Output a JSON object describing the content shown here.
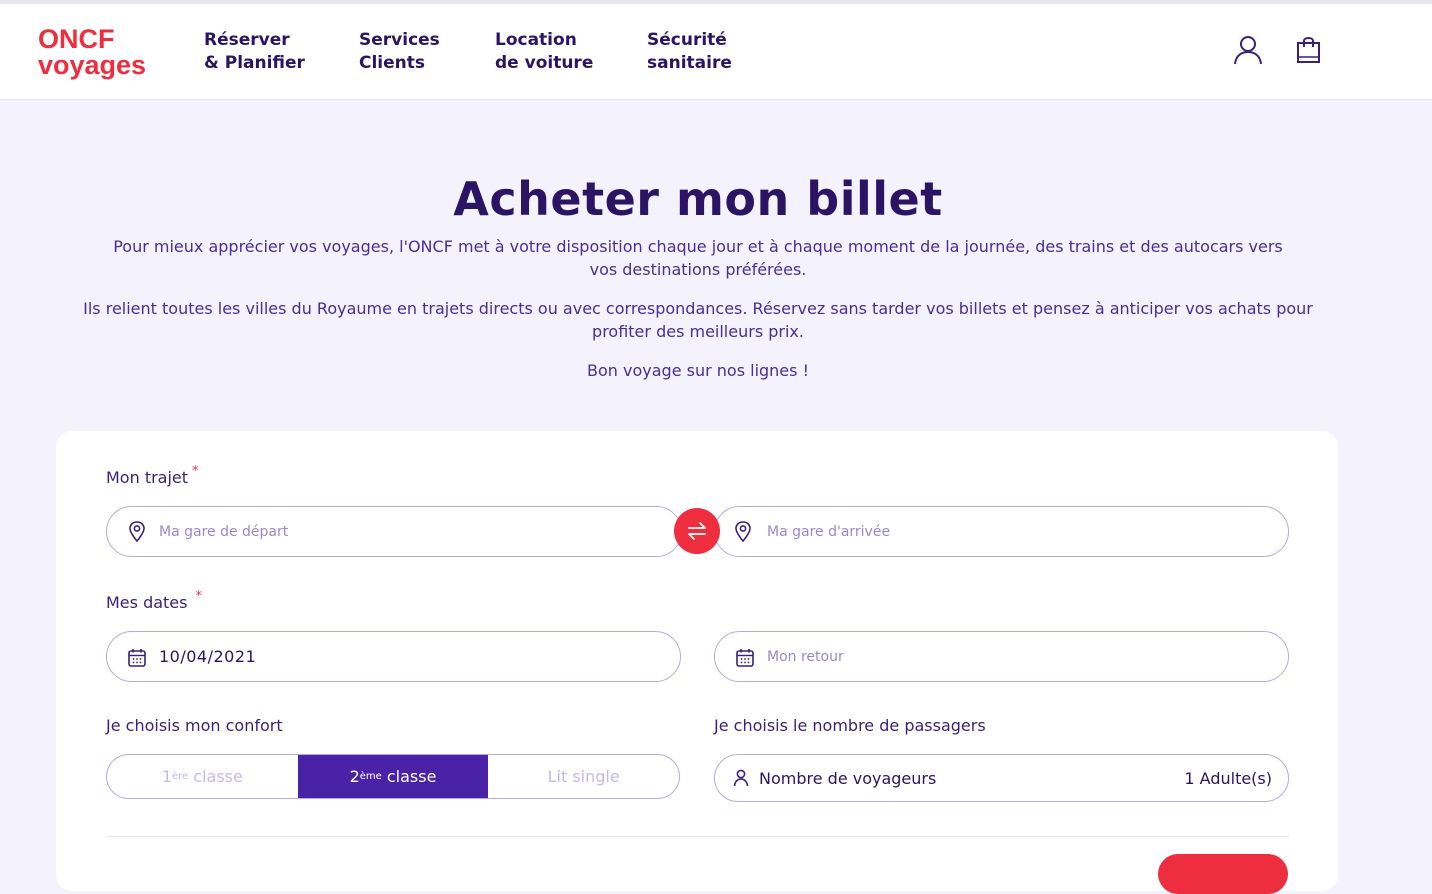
{
  "header": {
    "logo_line1": "ONCF",
    "logo_line2": "voyages",
    "nav": [
      {
        "line1": "Réserver",
        "line2": "& Planifier"
      },
      {
        "line1": "Services",
        "line2": "Clients"
      },
      {
        "line1": "Location",
        "line2": "de voiture"
      },
      {
        "line1": "Sécurité",
        "line2": "sanitaire"
      }
    ],
    "icons": [
      "user-icon",
      "shopping-bag-icon"
    ]
  },
  "hero": {
    "title": "Acheter mon billet",
    "p1": "Pour mieux apprécier vos voyages, l'ONCF met à votre disposition chaque jour et à chaque moment de la journée, des trains et des autocars vers vos destinations préférées.",
    "p2": "Ils relient toutes les villes du Royaume en trajets directs ou avec correspondances. Réservez sans tarder vos billets et pensez à anticiper vos achats pour profiter des meilleurs prix.",
    "p3": "Bon voyage sur nos lignes !"
  },
  "form": {
    "trajet_label": "Mon trajet",
    "required_mark": "*",
    "depart_placeholder": "Ma gare de départ",
    "arrivee_placeholder": "Ma gare d'arrivée",
    "dates_label": "Mes dates",
    "aller_value": "10/04/2021",
    "retour_placeholder": "Mon retour",
    "confort_label": "Je choisis mon confort",
    "classes": [
      {
        "num": "1",
        "sup": "ère",
        "rest": " classe",
        "active": false
      },
      {
        "num": "2",
        "sup": "ème",
        "rest": " classe",
        "active": true
      },
      {
        "num": "",
        "sup": "",
        "rest": "Lit single",
        "active": false
      }
    ],
    "passagers_label": "Je choisis le nombre de passagers",
    "passagers_field_label": "Nombre de voyageurs",
    "passagers_value": "1 Adulte(s)"
  },
  "colors": {
    "brand_red": "#ee2e3e",
    "brand_purple": "#4a22a8",
    "dark_purple": "#2b1463",
    "background": "#f4f2fc"
  }
}
